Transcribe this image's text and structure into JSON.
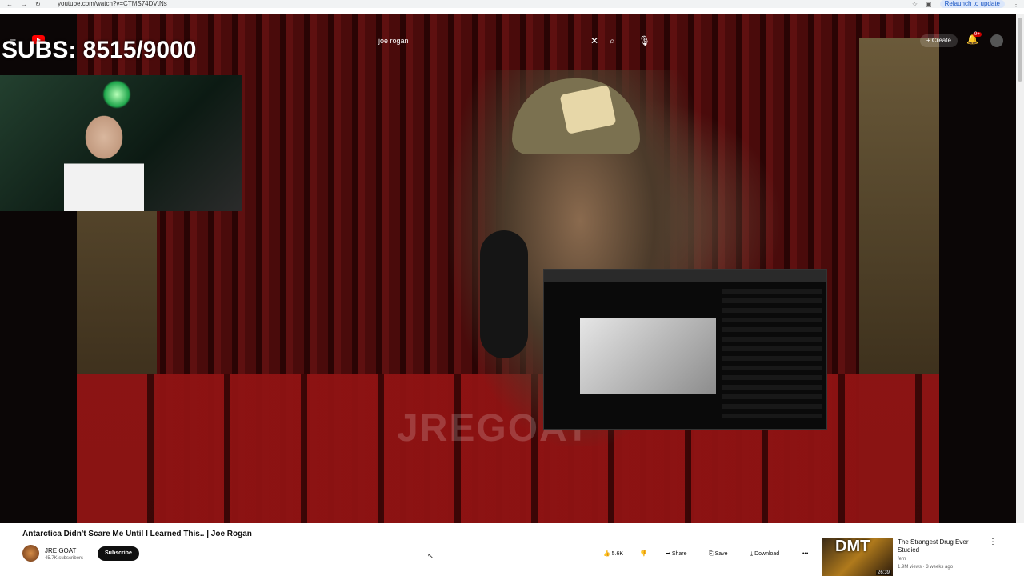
{
  "browser": {
    "url": "youtube.com/watch?v=CTMS74DVtNs",
    "relaunch_label": "Relaunch to update"
  },
  "header": {
    "search_value": "joe rogan",
    "create_label": "Create",
    "notifications_badge": "9+"
  },
  "player": {
    "subs_counter": "SUBS: 8515/9000",
    "watermark": "JREGOAT"
  },
  "video": {
    "title": "Antarctica Didn't Scare Me Until I Learned This.. | Joe Rogan",
    "channel_name": "JRE GOAT",
    "channel_subs": "45.7K subscribers",
    "subscribe_label": "Subscribe",
    "likes": "5.6K",
    "share_label": "Share",
    "save_label": "Save",
    "download_label": "Download"
  },
  "recommended": {
    "thumb_text": "DMT",
    "duration": "26:39",
    "title": "The Strangest Drug Ever Studied",
    "channel": "fern",
    "meta": "1.9M views · 3 weeks ago"
  },
  "colors": {
    "accent": "#ff0000",
    "subscribe_bg": "#0f0f0f",
    "curtain": "#4a0b0b"
  }
}
